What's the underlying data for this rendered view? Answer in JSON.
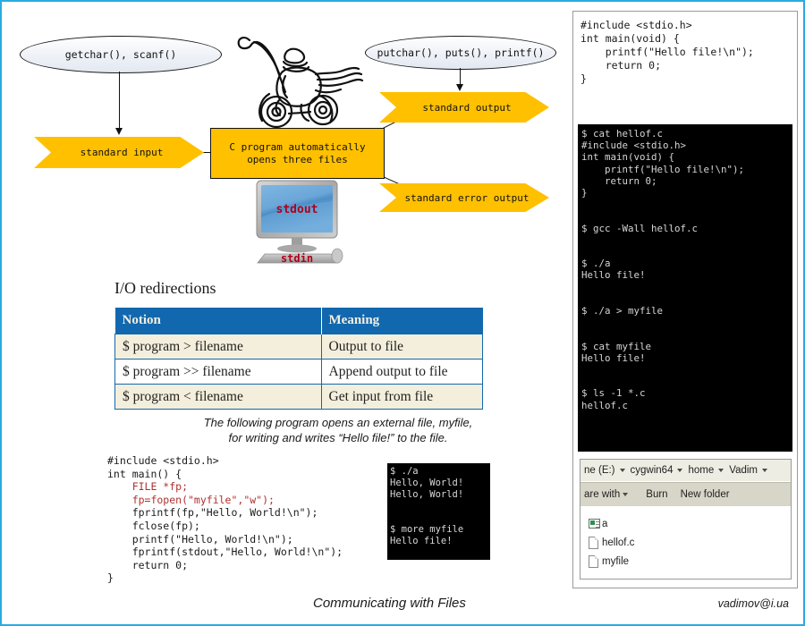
{
  "diagram": {
    "ellipse_input": "getchar(), scanf()",
    "ellipse_output": "putchar(), puts(), printf()",
    "arrow_stdin": "standard input",
    "arrow_stdout": "standard output",
    "arrow_stderr": "standard error output",
    "center_box_line1": "C program automatically",
    "center_box_line2": "opens three files",
    "monitor_screen_label": "stdout",
    "monitor_keyboard_label": "stdin",
    "colors": {
      "arrow_fill": "#FFC000",
      "ellipse_stroke": "#1a1a1a",
      "slide_border": "#29ABE2",
      "table_header": "#1268AE",
      "table_alt_row": "#F3EFDC",
      "monitor_screen": "#5B9BD5",
      "label_red": "#B0001A"
    }
  },
  "io_section": {
    "title": "I/O redirections",
    "table": {
      "headers": [
        "Notion",
        "Meaning"
      ],
      "rows": [
        [
          "$ program > filename",
          "Output to file"
        ],
        [
          "$ program >> filename",
          "Append output to file"
        ],
        [
          "$ program < filename",
          "Get input from file"
        ]
      ]
    },
    "caption_line1": "The following program opens an external file, myfile,",
    "caption_line2": "for writing and writes “Hello file!” to the file."
  },
  "example": {
    "code_lines": [
      "#include <stdio.h>",
      "int main() {",
      "    FILE *fp;",
      "    fp=fopen(\"myfile\",\"w\");",
      "    fprintf(fp,\"Hello, World!\\n\");",
      "    fclose(fp);",
      "    printf(\"Hello, World!\\n\");",
      "    fprintf(stdout,\"Hello, World!\\n\");",
      "    return 0;",
      "}"
    ],
    "mini_terminal": "$ ./a\nHello, World!\nHello, World!\n\n\n$ more myfile\nHello file!"
  },
  "right_panel": {
    "code": "#include <stdio.h>\nint main(void) {\n    printf(\"Hello file!\\n\");\n    return 0;\n}",
    "terminal": "$ cat hellof.c\n#include <stdio.h>\nint main(void) {\n    printf(\"Hello file!\\n\");\n    return 0;\n}\n\n\n$ gcc -Wall hellof.c\n\n\n$ ./a\nHello file!\n\n\n$ ./a > myfile\n\n\n$ cat myfile\nHello file!\n\n\n$ ls -1 *.c\nhellof.c",
    "explorer": {
      "breadcrumb": [
        "ne (E:)",
        "cygwin64",
        "home",
        "Vadim"
      ],
      "toolbar": [
        "are with",
        "Burn",
        "New folder"
      ],
      "files": [
        {
          "name": "a",
          "icon": "executable-icon"
        },
        {
          "name": "hellof.c",
          "icon": "document-icon"
        },
        {
          "name": "myfile",
          "icon": "document-icon"
        }
      ]
    }
  },
  "footer": {
    "title": "Communicating with Files",
    "email": "vadimov@i.ua"
  }
}
